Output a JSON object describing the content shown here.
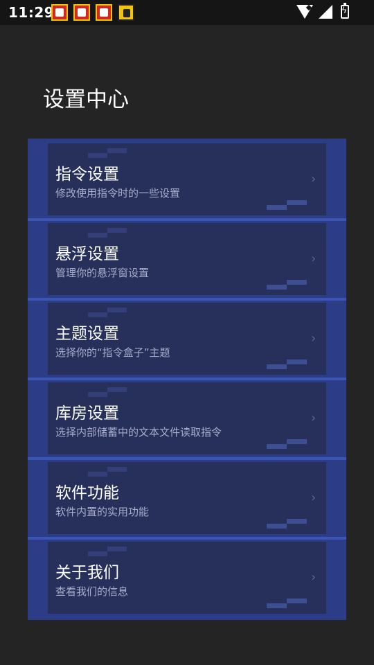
{
  "status_bar": {
    "time": "11:29",
    "notification_icons": [
      "app-notification-icon",
      "app-notification-icon",
      "app-notification-icon",
      "app-notification-icon-yellow"
    ],
    "system_icons": [
      "wifi-icon",
      "signal-icon",
      "battery-charging-icon"
    ]
  },
  "page": {
    "title": "设置中心"
  },
  "settings": [
    {
      "title": "指令设置",
      "subtitle": "修改使用指令时的一些设置"
    },
    {
      "title": "悬浮设置",
      "subtitle": "管理你的悬浮窗设置"
    },
    {
      "title": "主题设置",
      "subtitle": "选择你的“指令盒子”主题"
    },
    {
      "title": "库房设置",
      "subtitle": "选择内部储蓄中的文本文件读取指令"
    },
    {
      "title": "软件功能",
      "subtitle": "软件内置的实用功能"
    },
    {
      "title": "关于我们",
      "subtitle": "查看我们的信息"
    }
  ],
  "icons": {
    "chevron": "›"
  },
  "colors": {
    "background": "#242424",
    "panel": "#2d3c86",
    "item": "#27305b",
    "subtitle": "#a7accb"
  }
}
